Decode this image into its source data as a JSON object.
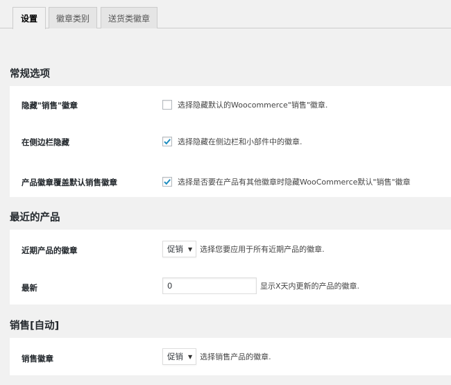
{
  "tabs": [
    {
      "label": "设置",
      "active": true
    },
    {
      "label": "徽章类别",
      "active": false
    },
    {
      "label": "送货类徽章",
      "active": false
    }
  ],
  "sections": {
    "general": {
      "title": "常规选项",
      "rows": {
        "hide_sale": {
          "label": "隐藏\"销售\"徽章",
          "checked": false,
          "description": "选择隐藏默认的Woocommerce\"销售\"徽章."
        },
        "hide_sidebar": {
          "label": "在侧边栏隐藏",
          "checked": true,
          "description": "选择隐藏在侧边栏和小部件中的徽章."
        },
        "override_sale": {
          "label": "产品徽章覆盖默认销售徽章",
          "checked": true,
          "description": "选择是否要在产品有其他徽章时隐藏WooCommerce默认\"销售\"徽章"
        }
      }
    },
    "recent": {
      "title": "最近的产品",
      "rows": {
        "recent_badge": {
          "label": "近期产品的徽章",
          "selected": "促销",
          "description": "选择您要应用于所有近期产品的徽章."
        },
        "newest": {
          "label": "最新",
          "value": "0",
          "description": "显示X天内更新的产品的徽章."
        }
      }
    },
    "sale_auto": {
      "title": "销售[自动]",
      "rows": {
        "sale_badge": {
          "label": "销售徽章",
          "selected": "促销",
          "description": "选择销售产品的徽章."
        }
      }
    }
  },
  "colors": {
    "page_bg": "#f1f1f1",
    "panel_bg": "#ffffff",
    "checkmark": "#1e8cbe"
  }
}
